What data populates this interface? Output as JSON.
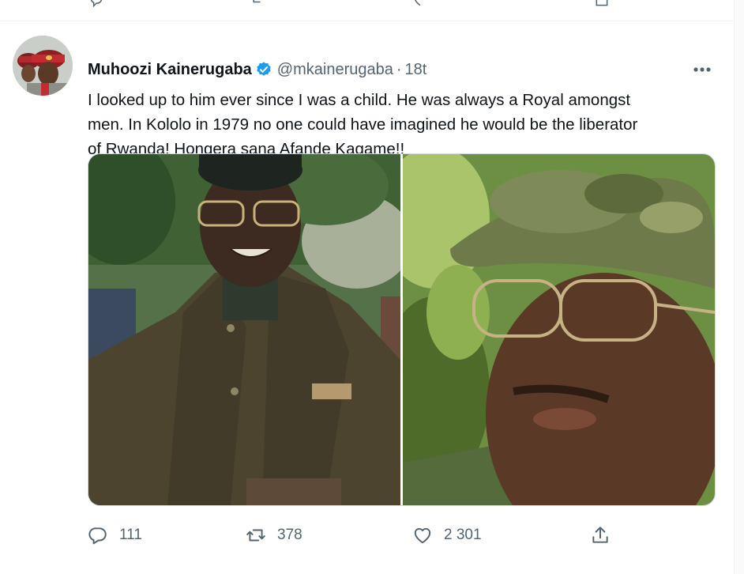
{
  "tweet": {
    "author_name": "Muhoozi Kainerugaba",
    "handle": "@mkainerugaba",
    "separator": "·",
    "time": "18t",
    "text": "I looked up to him ever since I was a child. He was always a Royal amongst\nmen. In Kololo in 1979 no one could have imagined he would be the liberator\nof Rwanda! Hongera sana Afande Kagame!!",
    "replies": "111",
    "retweets": "378",
    "likes": "2 301"
  },
  "icons": {
    "verified": "verified-badge-icon",
    "more": "more-icon",
    "reply": "reply-icon",
    "retweet": "retweet-icon",
    "like": "heart-icon",
    "share": "share-icon"
  },
  "colors": {
    "text": "#0f1419",
    "secondary": "#536471",
    "verified": "#1d9bf0",
    "border": "#eff3f4"
  }
}
